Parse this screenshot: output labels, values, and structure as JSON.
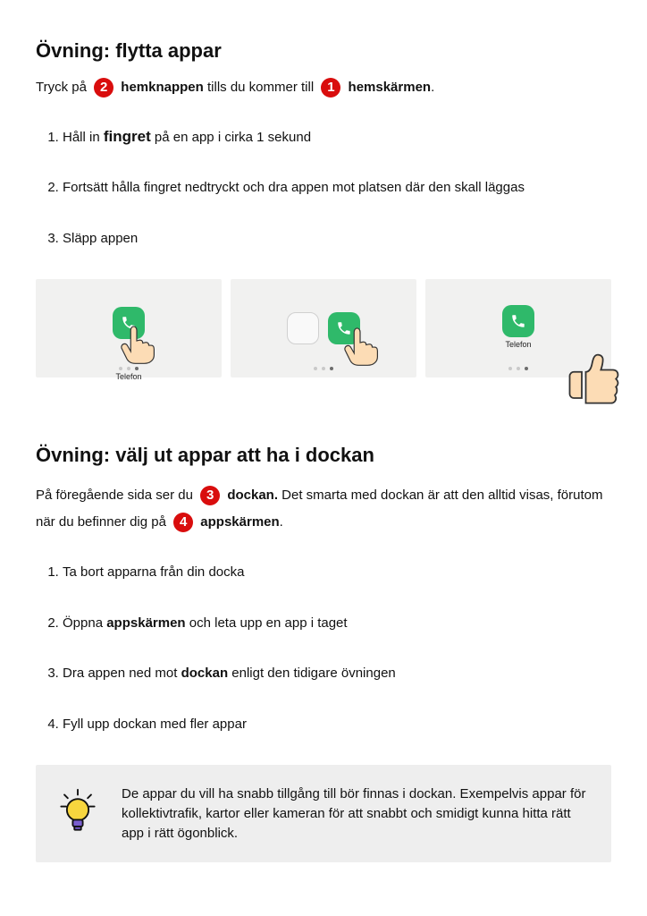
{
  "section1": {
    "title": "Övning: flytta appar",
    "intro_pre": "Tryck på",
    "badge2": "2",
    "intro_bold1": "hemknappen",
    "intro_mid": " tills du kommer till",
    "badge1": "1",
    "intro_bold2": "hemskärmen",
    "intro_post": ".",
    "steps": {
      "s1_pre": "Håll in ",
      "s1_bold": "fingret",
      "s1_post": " på en app i cirka 1 sekund",
      "s2": "Fortsätt hålla fingret nedtryckt och dra appen mot platsen där den skall läggas",
      "s3": "Släpp appen"
    },
    "app_label": "Telefon"
  },
  "section2": {
    "title": "Övning: välj ut appar att ha i dockan",
    "intro_pre": "På föregående sida ser du",
    "badge3": "3",
    "intro_bold1": "dockan.",
    "intro_mid": " Det smarta med dockan är att den alltid visas, förutom när du befinner dig på",
    "badge4": "4",
    "intro_bold2": "appskärmen",
    "intro_post": ".",
    "steps": {
      "s1": "Ta bort apparna från din docka",
      "s2_pre": "Öppna ",
      "s2_bold": "appskärmen",
      "s2_post": " och leta upp en app i taget",
      "s3_pre": "Dra appen ned mot ",
      "s3_bold": "dockan",
      "s3_post": " enligt den tidigare övningen",
      "s4": "Fyll upp dockan med fler appar"
    },
    "tip": "De appar du vill ha snabb tillgång till bör finnas i dockan. Exempelvis appar för kollektivtrafik, kartor eller kameran för att snabbt och smidigt kunna hitta rätt app i rätt ögonblick."
  }
}
